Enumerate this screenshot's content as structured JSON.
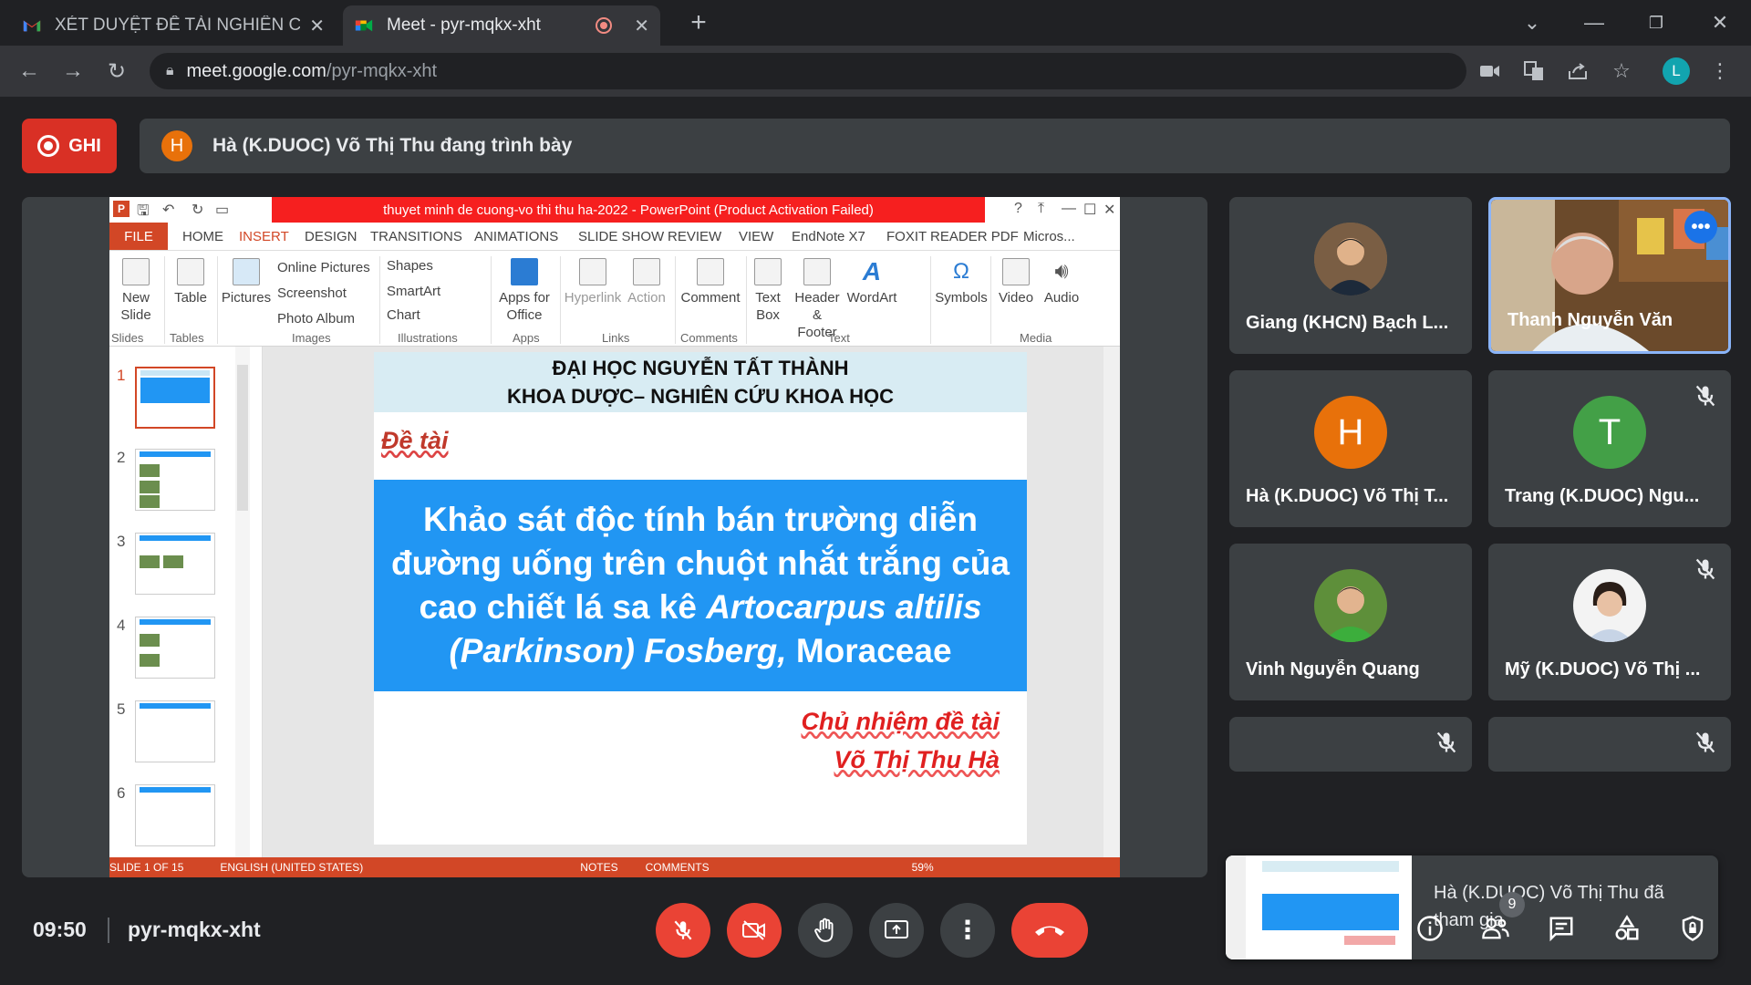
{
  "browser": {
    "tabs": [
      {
        "title": "XÉT DUYỆT ĐỀ TÀI NGHIÊN CỨU",
        "favicon": "gmail-icon"
      },
      {
        "title": "Meet - pyr-mqkx-xht",
        "favicon": "meet-icon"
      }
    ],
    "url_host": "meet.google.com",
    "url_path": "/pyr-mqkx-xht",
    "profile_initial": "L"
  },
  "meet": {
    "record_label": "GHI",
    "presenter_initial": "H",
    "presenter_text": "Hà (K.DUOC) Võ Thị Thu đang trình bày",
    "time": "09:50",
    "meeting_code": "pyr-mqkx-xht",
    "people_count": "9",
    "colors": {
      "record": "#d93025",
      "end_call": "#ea4335",
      "accent": "#1a73e8"
    }
  },
  "ppt": {
    "window_title": "thuyet minh de cuong-vo thi thu ha-2022 - PowerPoint (Product Activation Failed)",
    "tabs": [
      "FILE",
      "HOME",
      "INSERT",
      "DESIGN",
      "TRANSITIONS",
      "ANIMATIONS",
      "SLIDE SHOW",
      "REVIEW",
      "VIEW",
      "EndNote X7",
      "FOXIT READER PDF",
      "Micros..."
    ],
    "ribbon": {
      "new_slide": "New Slide",
      "table": "Table",
      "pictures": "Pictures",
      "online_pictures": "Online Pictures",
      "screenshot": "Screenshot",
      "photo_album": "Photo Album",
      "shapes": "Shapes",
      "smartart": "SmartArt",
      "chart": "Chart",
      "apps_for_office": "Apps for Office",
      "hyperlink": "Hyperlink",
      "action": "Action",
      "comment": "Comment",
      "text_box": "Text Box",
      "header_footer": "Header & Footer",
      "wordart": "WordArt",
      "symbols": "Symbols",
      "video": "Video",
      "audio": "Audio",
      "groups": [
        "Slides",
        "Tables",
        "Images",
        "Illustrations",
        "Apps",
        "Links",
        "Comments",
        "Text",
        "Media"
      ]
    },
    "slide_numbers": [
      "1",
      "2",
      "3",
      "4",
      "5",
      "6"
    ],
    "slide": {
      "header_line1": "ĐẠI HỌC NGUYỄN TẤT THÀNH",
      "header_line2": "KHOA DƯỢC– NGHIÊN CỨU KHOA HỌC",
      "topic_label": "Đề tài",
      "title_main": "Khảo sát độc tính bán trường diễn đường uống trên chuột nhắt trắng của cao chiết lá sa kê ",
      "title_italic": "Artocarpus altilis (Parkinson) Fosberg,",
      "title_end": "Moraceae",
      "sig_line1": "Chủ nhiệm đề tài",
      "sig_line2": "Võ Thị Thu Hà"
    },
    "status": {
      "slide_of": "SLIDE 1 OF 15",
      "language": "ENGLISH (UNITED STATES)",
      "notes": "NOTES",
      "comments": "COMMENTS",
      "zoom": "59%"
    }
  },
  "participants": [
    {
      "name": "Giang (KHCN) Bạch L...",
      "avatar": "photo",
      "muted": false
    },
    {
      "name": "Thanh Nguyễn Văn",
      "avatar": "video",
      "muted": false
    },
    {
      "name": "Hà (K.DUOC) Võ Thị T...",
      "initial": "H",
      "color": "#e8710a",
      "muted": false
    },
    {
      "name": "Trang (K.DUOC) Ngu...",
      "initial": "T",
      "color": "#43a047",
      "muted": true
    },
    {
      "name": "Vinh Nguyễn Quang",
      "avatar": "photo",
      "muted": false
    },
    {
      "name": "Mỹ (K.DUOC) Võ Thị ...",
      "avatar": "photo",
      "muted": true
    }
  ],
  "toast": {
    "text": "Hà (K.DUOC) Võ Thị Thu đã tham gia"
  }
}
